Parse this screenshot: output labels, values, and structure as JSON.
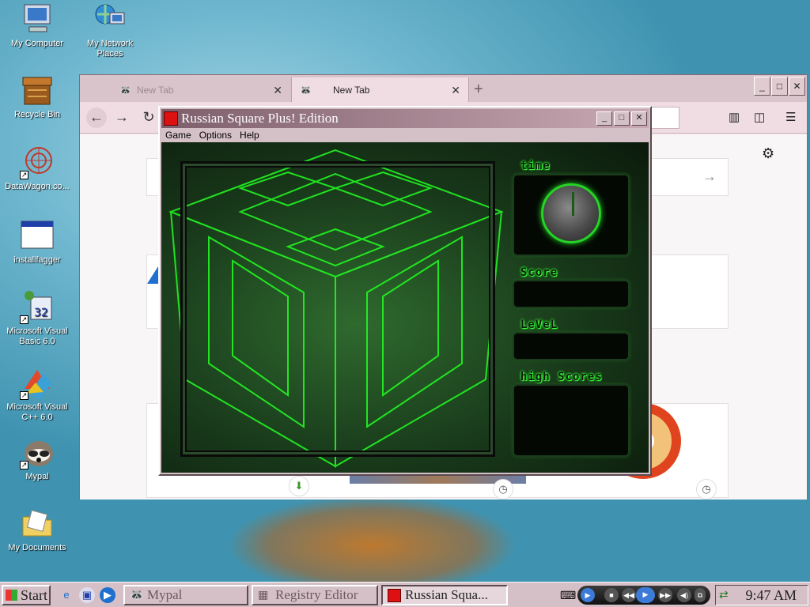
{
  "desktop": {
    "icons": [
      {
        "label": "My Computer",
        "icon": "computer-icon"
      },
      {
        "label": "My Network Places",
        "icon": "network-icon"
      },
      {
        "label": "Recycle Bin",
        "icon": "recycle-bin-icon"
      },
      {
        "label": "DataWagon.co...",
        "icon": "datawagon-icon"
      },
      {
        "label": "installfagger",
        "icon": "application-icon"
      },
      {
        "label": "Microsoft Visual Basic 6.0",
        "icon": "visual-basic-icon"
      },
      {
        "label": "Microsoft Visual C++ 6.0",
        "icon": "visual-cpp-icon"
      },
      {
        "label": "Mypal",
        "icon": "mypal-icon"
      },
      {
        "label": "My Documents",
        "icon": "folder-icon"
      }
    ]
  },
  "browser": {
    "tabs": [
      {
        "label": "New Tab",
        "active": false
      },
      {
        "label": "New Tab",
        "active": true
      }
    ],
    "new_tab_symbol": "+",
    "close_symbol": "✕"
  },
  "game": {
    "title": "Russian Square Plus! Edition",
    "menu": [
      "Game",
      "Options",
      "Help"
    ],
    "panels": {
      "time": "time",
      "score": "Score",
      "level": "LeVeL",
      "high_scores": "high Scores"
    }
  },
  "taskbar": {
    "start_label": "Start",
    "tasks": [
      {
        "label": "Mypal",
        "active": false,
        "icon": "mypal-icon"
      },
      {
        "label": "Registry Editor",
        "active": false,
        "icon": "registry-icon"
      },
      {
        "label": "Russian Squa...",
        "active": true,
        "icon": "cube-icon"
      }
    ],
    "clock": "9:47 AM"
  },
  "colors": {
    "window_frame": "#d4c1c7",
    "title_gradient_start": "#7d5f6b",
    "game_glow": "#39ff39",
    "accent_green": "#25d425"
  }
}
